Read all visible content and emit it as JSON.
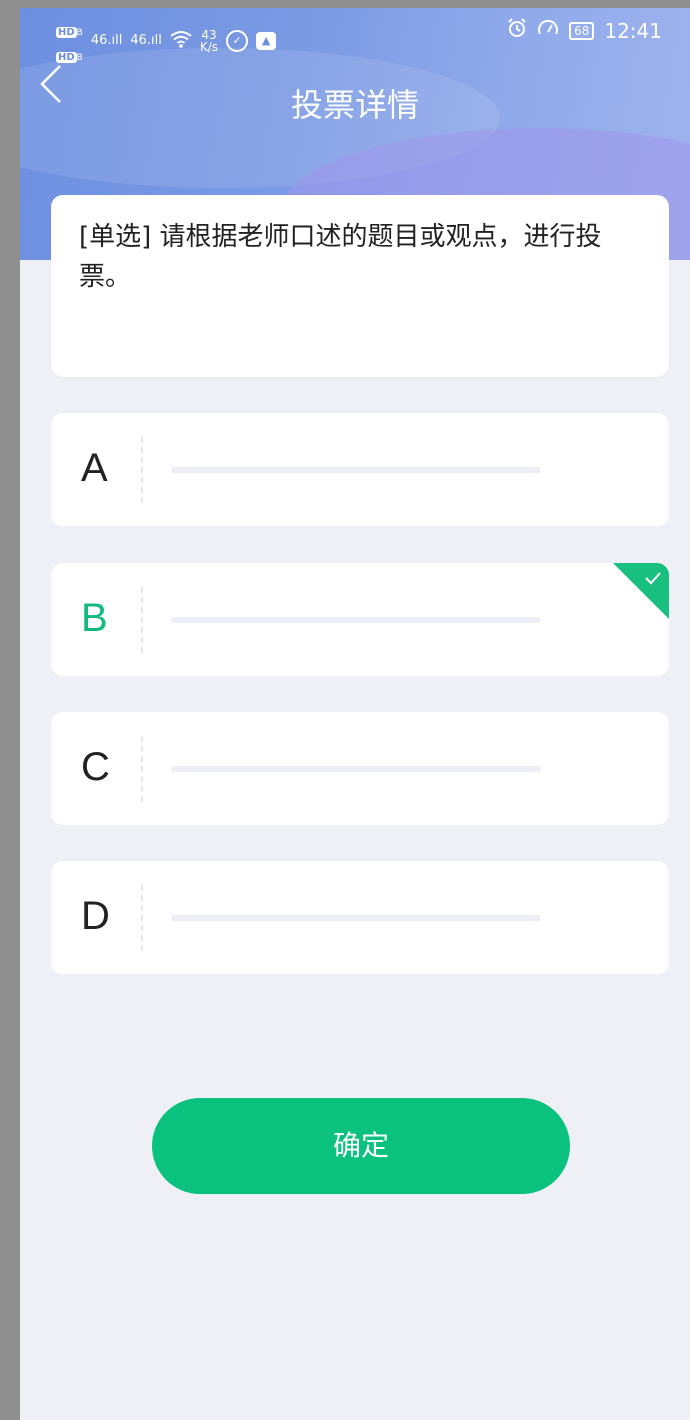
{
  "status_bar": {
    "hd1": "HD",
    "hd1_sub": "B",
    "hd2": "HD",
    "hd2_sub": "B",
    "signal1": "46.ıll",
    "signal2": "46.ıll",
    "wifi": "wifi-icon",
    "speed_value": "43",
    "speed_unit": "K/s",
    "battery": "68",
    "time": "12:41"
  },
  "header": {
    "title": "投票详情",
    "back_icon": "chevron-left-icon"
  },
  "question": {
    "text": "[单选] 请根据老师口述的题目或观点，进行投票。"
  },
  "options": [
    {
      "letter": "A",
      "selected": false
    },
    {
      "letter": "B",
      "selected": true
    },
    {
      "letter": "C",
      "selected": false
    },
    {
      "letter": "D",
      "selected": false
    }
  ],
  "confirm_label": "确定",
  "colors": {
    "accent_green": "#0bc17e",
    "header_blue": "#7b9ae4",
    "page_bg": "#eef0f6"
  }
}
